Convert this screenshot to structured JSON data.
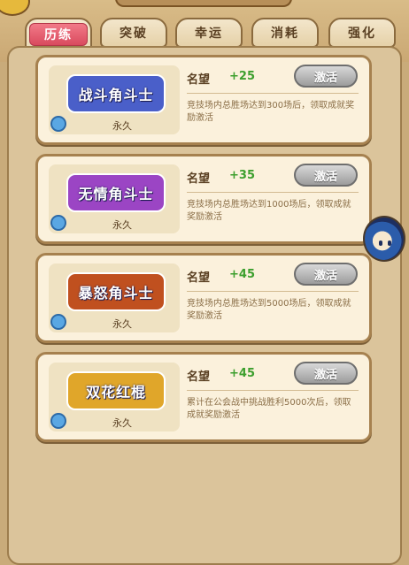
{
  "tabs": [
    {
      "label": "历练",
      "active": true
    },
    {
      "label": "突破",
      "active": false
    },
    {
      "label": "幸运",
      "active": false
    },
    {
      "label": "消耗",
      "active": false
    },
    {
      "label": "强化",
      "active": false
    }
  ],
  "cards": [
    {
      "badge_text": "战斗角斗士",
      "badge_color": "#4a5fc9",
      "duration": "永久",
      "rep_label": "名望",
      "rep_value": "+25",
      "button": "激活",
      "desc": "竞技场内总胜场达到300场后，领取成就奖励激活"
    },
    {
      "badge_text": "无情角斗士",
      "badge_color": "#9b45c4",
      "duration": "永久",
      "rep_label": "名望",
      "rep_value": "+35",
      "button": "激活",
      "desc": "竞技场内总胜场达到1000场后，领取成就奖励激活"
    },
    {
      "badge_text": "暴怒角斗士",
      "badge_color": "#c0501f",
      "duration": "永久",
      "rep_label": "名望",
      "rep_value": "+45",
      "button": "激活",
      "desc": "竞技场内总胜场达到5000场后，领取成就奖励激活"
    },
    {
      "badge_text": "双花红棍",
      "badge_color": "#e0a62a",
      "duration": "永久",
      "rep_label": "名望",
      "rep_value": "+45",
      "button": "激活",
      "desc": "累计在公会战中挑战胜利5000次后，领取成就奖励激活"
    }
  ]
}
